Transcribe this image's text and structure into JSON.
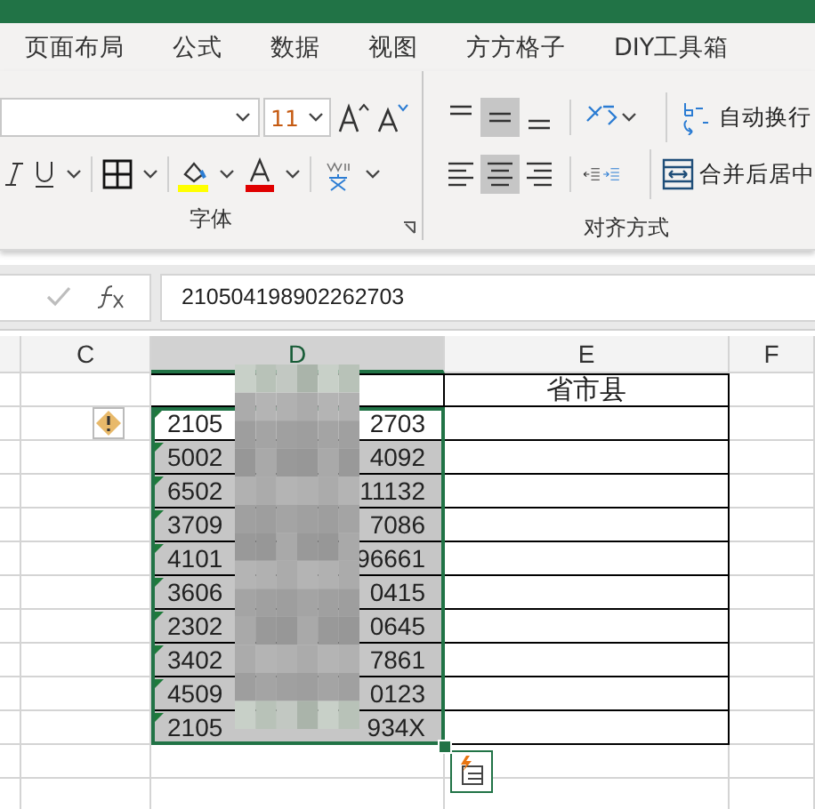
{
  "ribbon_tabs": [
    {
      "label": "页面布局",
      "selected": false
    },
    {
      "label": "公式",
      "selected": false
    },
    {
      "label": "数据",
      "selected": false
    },
    {
      "label": "视图",
      "selected": false
    },
    {
      "label": "方方格子",
      "selected": false
    },
    {
      "label": "DIY工具箱",
      "selected": false
    }
  ],
  "font_group": {
    "font_size": "11",
    "label": "字体"
  },
  "alignment_group": {
    "label": "对齐方式",
    "wrap_text": "自动换行",
    "merge_center": "合并后居中",
    "vertical": [
      {
        "kind": "top",
        "selected": false
      },
      {
        "kind": "middle",
        "selected": true
      },
      {
        "kind": "bottom",
        "selected": false
      }
    ],
    "horizontal": [
      {
        "kind": "left",
        "selected": false
      },
      {
        "kind": "center",
        "selected": true
      },
      {
        "kind": "right",
        "selected": false
      }
    ]
  },
  "formula_bar": {
    "value": "210504198902262703"
  },
  "columns": [
    {
      "label": "C",
      "selected": false
    },
    {
      "label": "D",
      "selected": true
    },
    {
      "label": "E",
      "selected": false
    },
    {
      "label": "F",
      "selected": false
    }
  ],
  "header_cell": "省市县",
  "rows": [
    {
      "id_start": "2105",
      "id_end": "2703",
      "active": true
    },
    {
      "id_start": "5002",
      "id_end": "4092",
      "active": false
    },
    {
      "id_start": "6502",
      "id_end": "11132",
      "active": false
    },
    {
      "id_start": "3709",
      "id_end": "7086",
      "active": false
    },
    {
      "id_start": "4101",
      "id_end": "96661",
      "active": false
    },
    {
      "id_start": "3606",
      "id_end": "0415",
      "active": false
    },
    {
      "id_start": "2302",
      "id_end": "0645",
      "active": false
    },
    {
      "id_start": "3402",
      "id_end": "7861",
      "active": false
    },
    {
      "id_start": "4509",
      "id_end": "0123",
      "active": false
    },
    {
      "id_start": "2105",
      "id_end": "934X",
      "active": false
    }
  ]
}
